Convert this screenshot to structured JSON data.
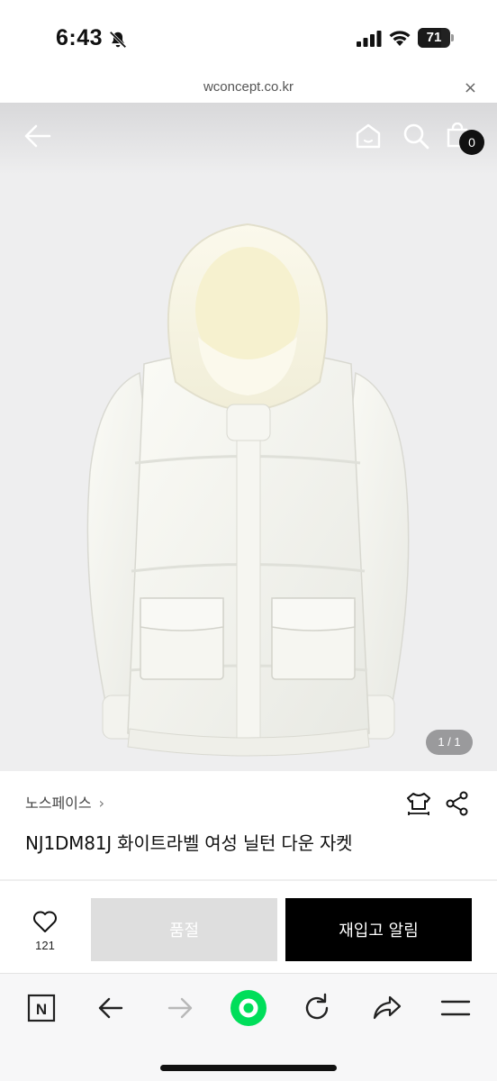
{
  "status_bar": {
    "time": "6:43",
    "battery": "71",
    "battery_level": 0.71
  },
  "url_bar": {
    "url": "wconcept.co.kr",
    "close_label": "×"
  },
  "header": {
    "cart_count": "0"
  },
  "image_gallery": {
    "indicator": "1 / 1"
  },
  "product": {
    "brand": "노스페이스",
    "brand_chevron": "›",
    "name": "NJ1DM81J 화이트라벨 여성 닐턴 다운 자켓"
  },
  "purchase": {
    "like_count": "121",
    "soldout_label": "품절",
    "restock_label": "재입고 알림"
  },
  "browser_toolbar": {
    "naver_label": "N",
    "accent_color": "#00de5a"
  }
}
